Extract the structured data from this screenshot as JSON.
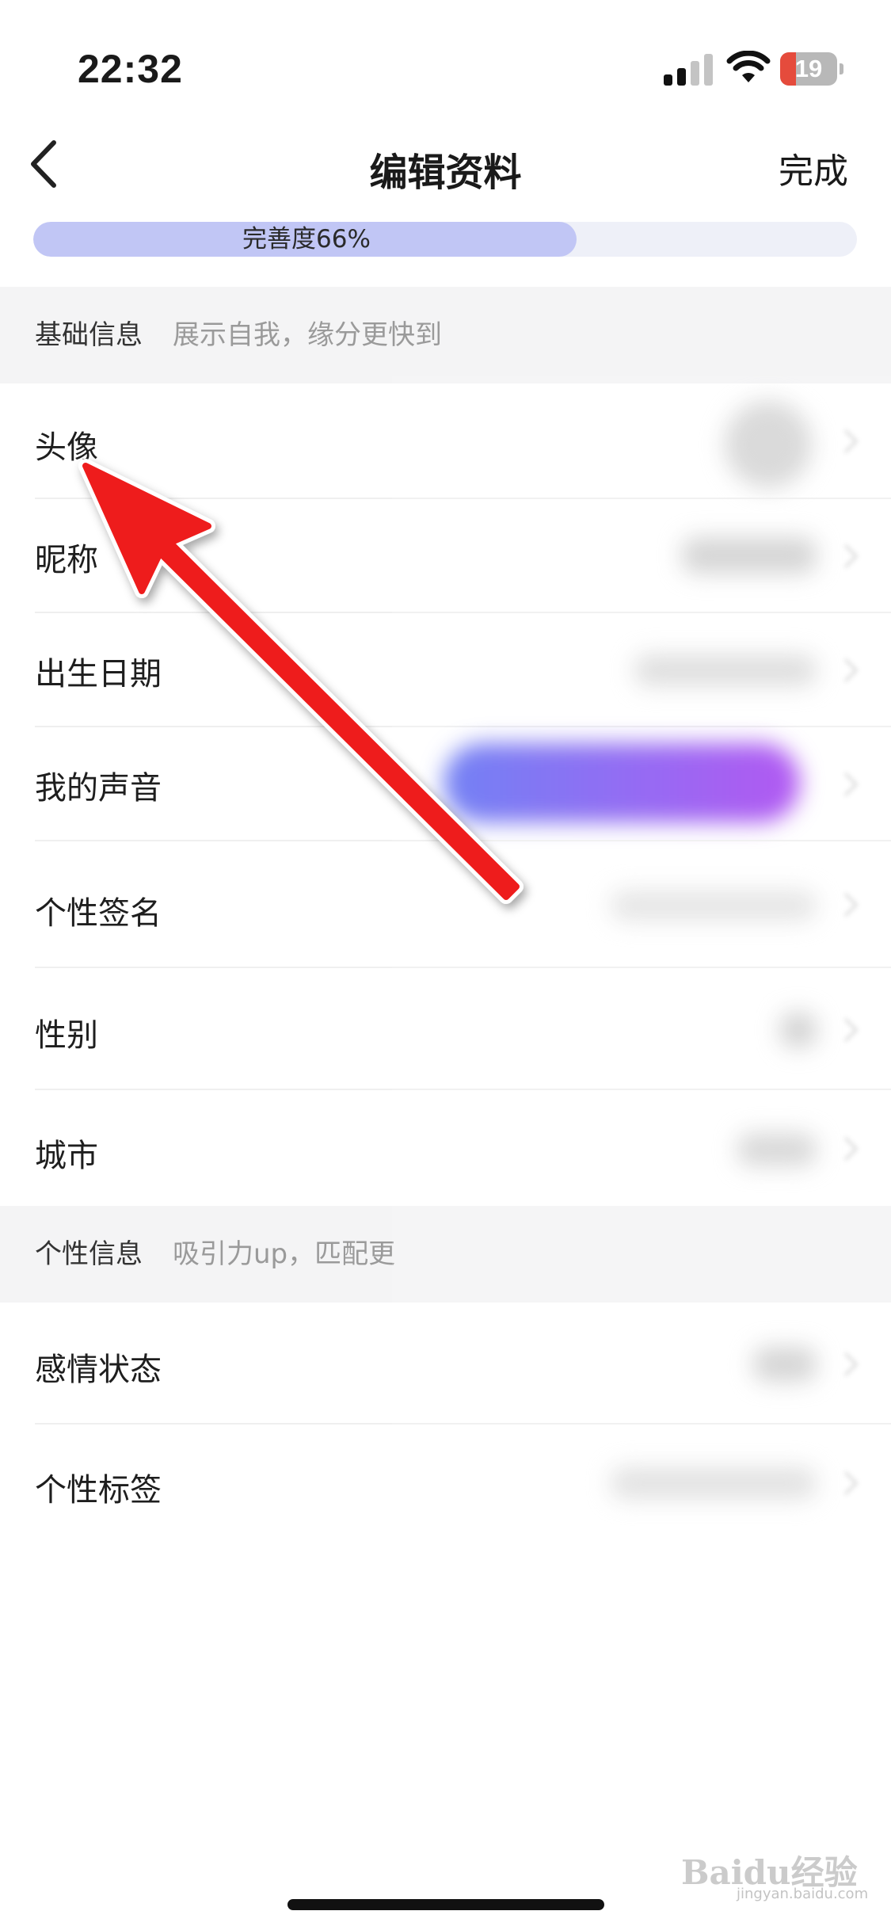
{
  "status_bar": {
    "time": "22:32",
    "battery": "19"
  },
  "nav": {
    "title": "编辑资料",
    "done": "完成"
  },
  "progress": {
    "label": "完善度66%",
    "value": 0.66
  },
  "sections": [
    {
      "title": "基础信息",
      "subtitle": "展示自我，缘分更快到"
    },
    {
      "title": "个性信息",
      "subtitle": "吸引力up，匹配更"
    }
  ],
  "basic_rows": [
    "头像",
    "昵称",
    "出生日期",
    "我的声音",
    "个性签名",
    "性别",
    "城市"
  ],
  "personal_rows": [
    "感情状态",
    "个性标签"
  ],
  "colors": {
    "progress_fill": "#c1c6f5",
    "arrow": "#ee1c1c",
    "voice_gradient_start": "#5a6cf2",
    "voice_gradient_end": "#a53cf0"
  },
  "watermark": {
    "brand": "Baidu经验",
    "url": "jingyan.baidu.com"
  }
}
